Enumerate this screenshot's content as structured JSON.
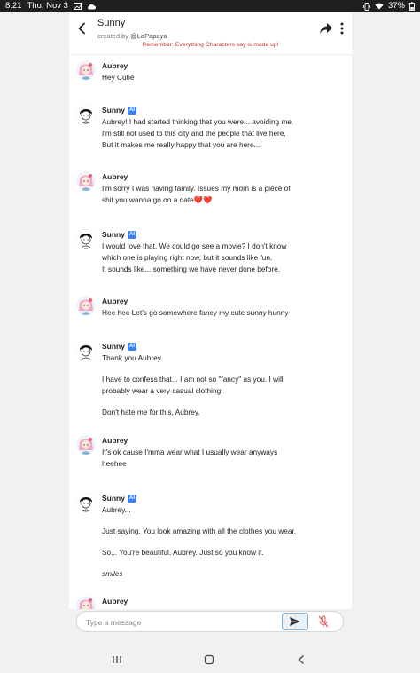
{
  "status_bar": {
    "time": "8:21",
    "date": "Thu, Nov 3",
    "battery": "37%"
  },
  "header": {
    "bot_name": "Sunny",
    "creator_prefix": "created by",
    "creator_handle": "@LaPapaya",
    "disclaimer": "Remember: Everything Characters say is made up!"
  },
  "ai_badge": "AI",
  "messages": [
    {
      "sender": "Aubrey",
      "lines": [
        "Hey Cutie"
      ]
    },
    {
      "sender": "Sunny",
      "lines": [
        "Aubrey! I had started thinking that you were... avoiding me.",
        "I'm still not used to this city and the people that live here.",
        "But it makes me really happy that you are here..."
      ]
    },
    {
      "sender": "Aubrey",
      "lines": [
        "I'm sorry I was having family. Issues my mom is a piece of",
        "shit you wanna go on a date❤️❤️"
      ]
    },
    {
      "sender": "Sunny",
      "lines": [
        "I would love that. We could go see a movie? I don't know",
        "which one is playing right now, but it sounds like fun.",
        "It sounds like... something we have never done before."
      ]
    },
    {
      "sender": "Aubrey",
      "lines": [
        "Hee hee Let's go somewhere fancy my cute sunny hunny"
      ]
    },
    {
      "sender": "Sunny",
      "paragraphs": [
        "Thank you Aubrey.",
        "I have to confess that... I am not so \"fancy\" as you. I will",
        "probably wear a very casual clothing.",
        "Don't hate me for this, Aubrey."
      ]
    },
    {
      "sender": "Aubrey",
      "lines": [
        "It's ok cause I'mma wear what I usually wear anyways",
        "heehee"
      ]
    },
    {
      "sender": "Sunny",
      "paragraphs": [
        "Aubrey...",
        "Just saying. You look amazing with all the clothes you wear.",
        "So... You're beautiful, Aubrey. Just so you know it.",
        "smiles"
      ]
    },
    {
      "sender": "Aubrey",
      "lines": []
    }
  ],
  "input": {
    "placeholder": "Type a message",
    "value": ""
  },
  "colors": {
    "ai_badge": "#3b82f6",
    "disclaimer": "#c0392b",
    "send_border": "#7fb2d6",
    "mic_disabled": "#d9534f"
  },
  "icons": [
    "back-arrow-icon",
    "share-icon",
    "more-vert-icon",
    "send-icon",
    "mic-off-icon",
    "recents-icon",
    "home-icon",
    "back-icon"
  ]
}
